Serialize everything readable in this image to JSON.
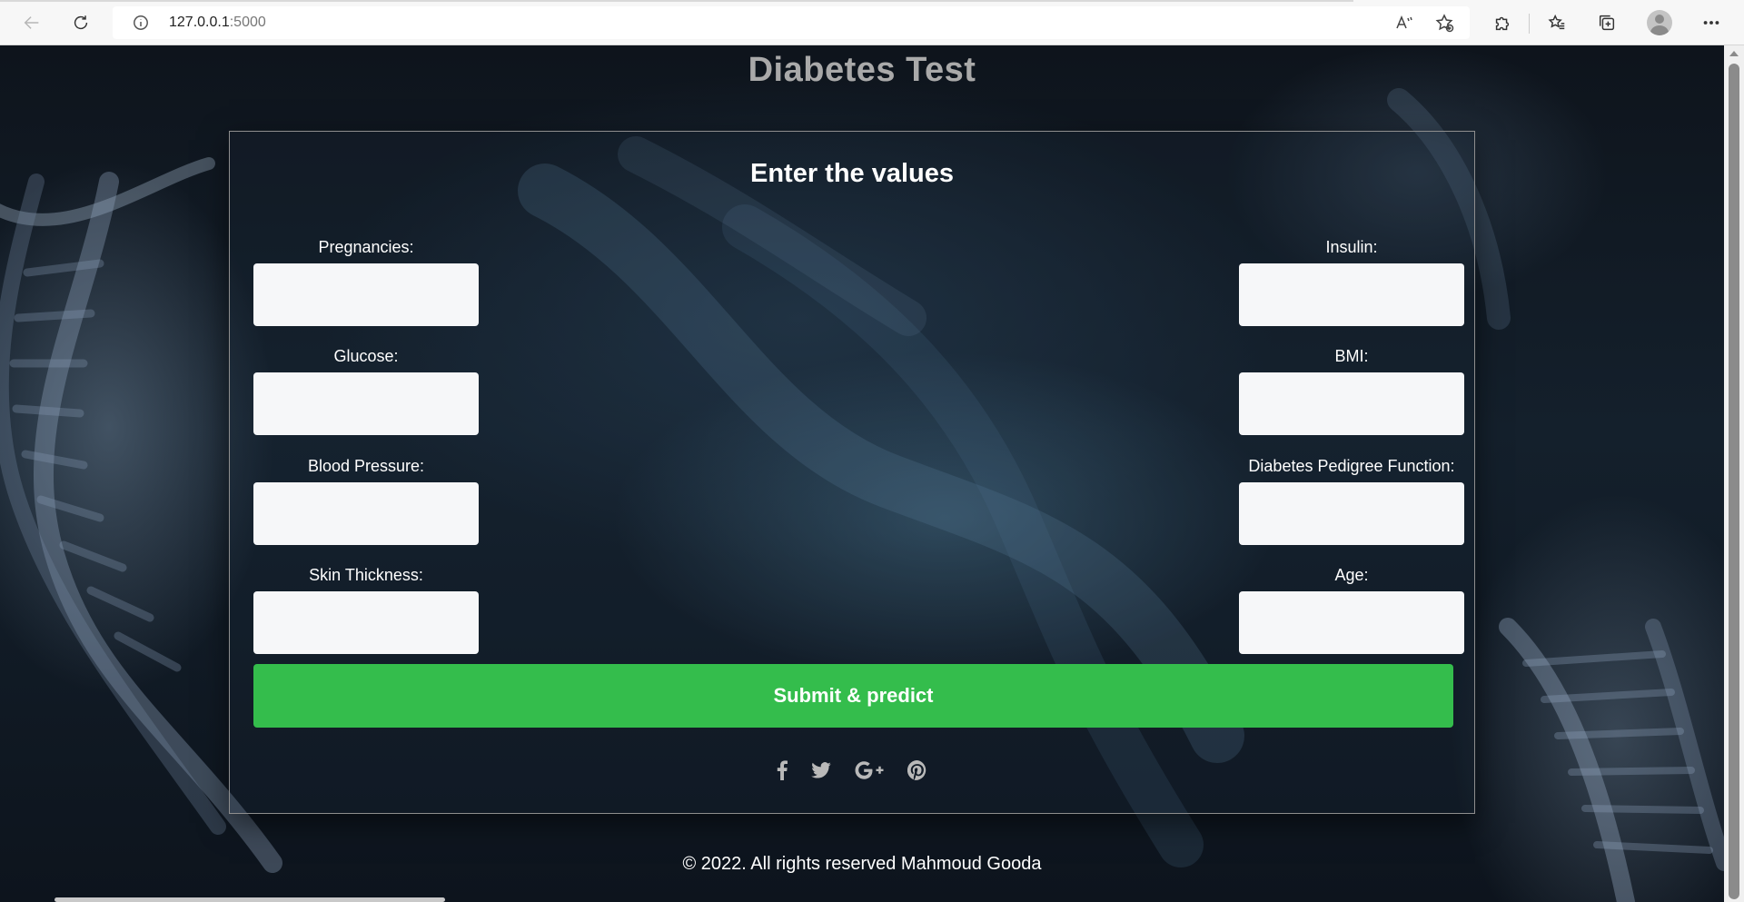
{
  "browser": {
    "url_host": "127.0.0.1",
    "url_port": ":5000",
    "icons": {
      "back": "back-arrow-icon",
      "refresh": "refresh-icon",
      "info": "info-icon",
      "read_aloud": "read-aloud-icon",
      "add_favorite": "add-favorite-icon",
      "extensions": "puzzle-icon",
      "favorites": "favorites-icon",
      "collections": "collections-icon",
      "profile": "avatar",
      "menu": "more-dots-icon"
    }
  },
  "page": {
    "title": "Diabetes Test",
    "form_heading": "Enter the values",
    "left_fields": [
      {
        "label": "Pregnancies:",
        "value": ""
      },
      {
        "label": "Glucose:",
        "value": ""
      },
      {
        "label": "Blood Pressure:",
        "value": ""
      },
      {
        "label": "Skin Thickness:",
        "value": ""
      }
    ],
    "right_fields": [
      {
        "label": "Insulin:",
        "value": ""
      },
      {
        "label": "BMI:",
        "value": ""
      },
      {
        "label": "Diabetes Pedigree Function:",
        "value": ""
      },
      {
        "label": "Age:",
        "value": ""
      }
    ],
    "submit_label": "Submit & predict",
    "social_icons": [
      "facebook-icon",
      "twitter-icon",
      "google-plus-icon",
      "pinterest-icon"
    ],
    "footer": "© 2022. All rights reserved Mahmoud Gooda"
  },
  "colors": {
    "title": "#a9a9a9",
    "submit_bg": "#34bd4c",
    "input_bg": "#f6f7f9",
    "card_border": "#8e8e8e"
  }
}
